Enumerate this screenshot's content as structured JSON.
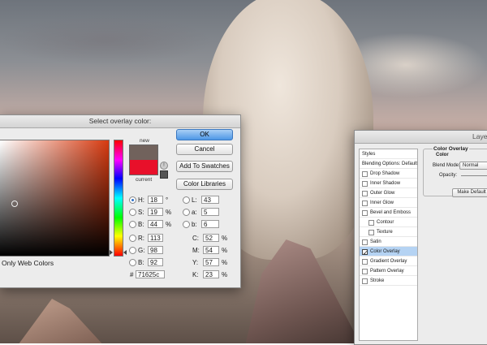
{
  "picker": {
    "title": "Select overlay color:",
    "label_new": "new",
    "label_current": "current",
    "new_color": "#71625c",
    "current_color": "#e8102a",
    "buttons": {
      "ok": "OK",
      "cancel": "Cancel",
      "add_swatches": "Add To Swatches",
      "color_libraries": "Color Libraries"
    },
    "fields": {
      "H": {
        "value": "18",
        "unit": "°"
      },
      "S": {
        "value": "19",
        "unit": "%"
      },
      "B": {
        "value": "44",
        "unit": "%"
      },
      "R": {
        "value": "113"
      },
      "G": {
        "value": "98"
      },
      "Bl": {
        "value": "92"
      },
      "L": {
        "value": "43"
      },
      "a": {
        "value": "5"
      },
      "b": {
        "value": "6"
      },
      "C": {
        "value": "52",
        "unit": "%"
      },
      "M": {
        "value": "54",
        "unit": "%"
      },
      "Y": {
        "value": "57",
        "unit": "%"
      },
      "K": {
        "value": "23",
        "unit": "%"
      }
    },
    "labels": {
      "H": "H:",
      "S": "S:",
      "B": "B:",
      "R": "R:",
      "G": "G:",
      "Bl": "B:",
      "L": "L:",
      "a": "a:",
      "b": "b:",
      "C": "C:",
      "M": "M:",
      "Y": "Y:",
      "K": "K:",
      "hash": "#"
    },
    "hex": "71625c",
    "web_colors_label": "Only Web Colors"
  },
  "layer_style": {
    "title": "Layer Style",
    "items": [
      {
        "label": "Styles",
        "checkbox": false,
        "checked": false,
        "selected": false,
        "indent": 0
      },
      {
        "label": "Blending Options: Default",
        "checkbox": false,
        "checked": false,
        "selected": false,
        "indent": 0
      },
      {
        "label": "Drop Shadow",
        "checkbox": true,
        "checked": false,
        "selected": false,
        "indent": 0
      },
      {
        "label": "Inner Shadow",
        "checkbox": true,
        "checked": false,
        "selected": false,
        "indent": 0
      },
      {
        "label": "Outer Glow",
        "checkbox": true,
        "checked": false,
        "selected": false,
        "indent": 0
      },
      {
        "label": "Inner Glow",
        "checkbox": true,
        "checked": false,
        "selected": false,
        "indent": 0
      },
      {
        "label": "Bevel and Emboss",
        "checkbox": true,
        "checked": false,
        "selected": false,
        "indent": 0
      },
      {
        "label": "Contour",
        "checkbox": true,
        "checked": false,
        "selected": false,
        "indent": 1
      },
      {
        "label": "Texture",
        "checkbox": true,
        "checked": false,
        "selected": false,
        "indent": 1
      },
      {
        "label": "Satin",
        "checkbox": true,
        "checked": false,
        "selected": false,
        "indent": 0
      },
      {
        "label": "Color Overlay",
        "checkbox": true,
        "checked": true,
        "selected": true,
        "indent": 0
      },
      {
        "label": "Gradient Overlay",
        "checkbox": true,
        "checked": false,
        "selected": false,
        "indent": 0
      },
      {
        "label": "Pattern Overlay",
        "checkbox": true,
        "checked": false,
        "selected": false,
        "indent": 0
      },
      {
        "label": "Stroke",
        "checkbox": true,
        "checked": false,
        "selected": false,
        "indent": 0
      }
    ],
    "overlay": {
      "title": "Color Overlay",
      "subtitle": "Color",
      "blend_mode_label": "Blend Mode:",
      "blend_mode_value": "Normal",
      "opacity_label": "Opacity:",
      "make_default": "Make Default"
    }
  }
}
